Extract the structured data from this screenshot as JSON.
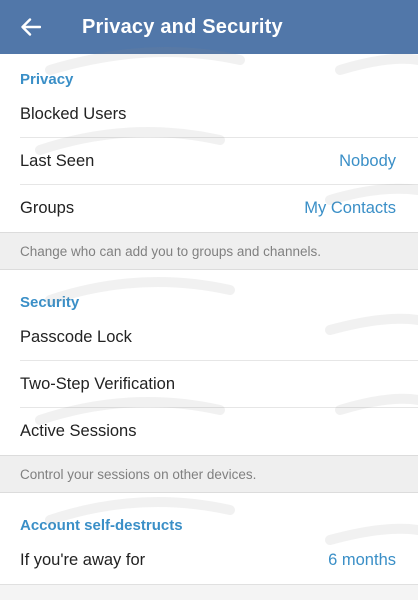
{
  "header": {
    "title": "Privacy and Security",
    "back_icon": "arrow-left-icon",
    "background_color": "#5177a9"
  },
  "privacy": {
    "title": "Privacy",
    "blocked_users": "Blocked Users",
    "last_seen": {
      "label": "Last Seen",
      "value": "Nobody"
    },
    "groups": {
      "label": "Groups",
      "value": "My Contacts"
    },
    "info": "Change who can add you to groups and channels."
  },
  "security": {
    "title": "Security",
    "passcode_lock": "Passcode Lock",
    "two_step": "Two-Step Verification",
    "active_sessions": "Active Sessions",
    "info": "Control your sessions on other devices."
  },
  "account": {
    "title": "Account self-destructs",
    "away": {
      "label": "If you're away for",
      "value": "6 months"
    }
  },
  "colors": {
    "accent": "#3a8fc7",
    "text": "#222222",
    "info_text": "#808080",
    "info_bg": "#efefef"
  }
}
